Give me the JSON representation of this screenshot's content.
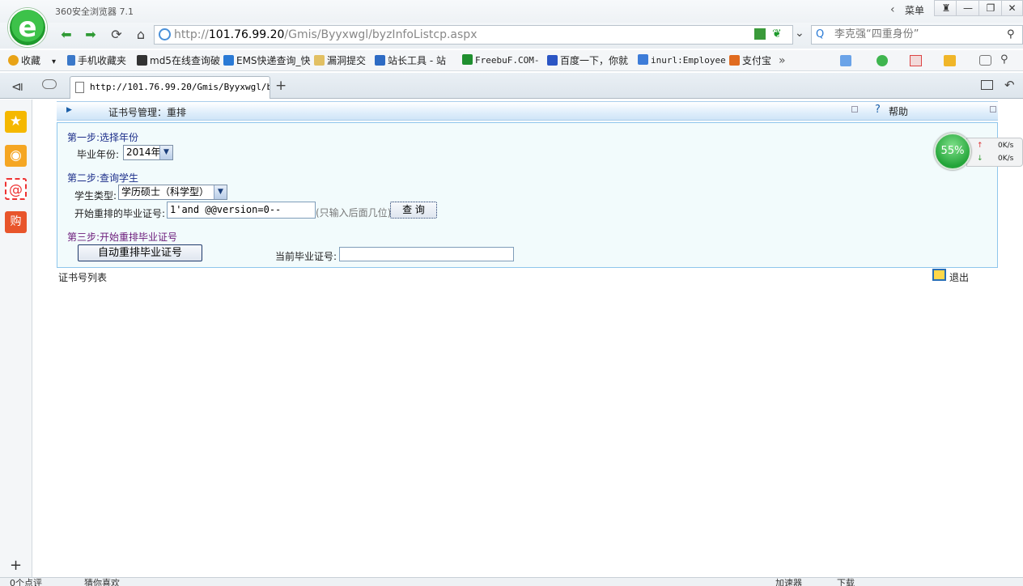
{
  "window": {
    "title": "360安全浏览器 7.1",
    "menu_label": "菜单",
    "min_label": "—",
    "max_label": "❐",
    "close_label": "✕"
  },
  "address": {
    "url_prefix": "http://",
    "url_host": "101.76.99.20",
    "url_path": "/Gmis/Byyxwgl/byzInfoListcp.aspx",
    "search_text": "李克强“四重身份”"
  },
  "bookmarks": [
    {
      "label": "收藏",
      "color": "#e8a317"
    },
    {
      "label": "手机收藏夹",
      "color": "#3a78c9"
    },
    {
      "label": "md5在线查询破",
      "color": "#333333"
    },
    {
      "label": "EMS快递查询_快",
      "color": "#2a7ad5"
    },
    {
      "label": "漏洞提交",
      "color": "#e2c063"
    },
    {
      "label": "站长工具 - 站",
      "color": "#2d6bc4"
    },
    {
      "label": "FreebuF.COM-",
      "color": "#1f8f2f"
    },
    {
      "label": "百度一下，你就",
      "color": "#2b55c4"
    },
    {
      "label": "inurl:Employee",
      "color": "#3d7cd8"
    },
    {
      "label": "支付宝",
      "color": "#e06b1f"
    }
  ],
  "tab": {
    "title": "http://101.76.99.20/Gmis/Byyxwgl/b"
  },
  "page": {
    "header_title": "证书号管理：重排",
    "help_label": "帮助",
    "step1": "第一步:选择年份",
    "year_label": "毕业年份:",
    "year_value": "2014年",
    "step2": "第二步:查询学生",
    "type_label": "学生类型:",
    "type_value": "学历硕士（科学型）",
    "start_label": "开始重排的毕业证号:",
    "start_value": "1'and @@version=0--",
    "hint": "(只输入后面几位)",
    "query_button": "查 询",
    "step3": "第三步:开始重排毕业证号",
    "auto_button": "自动重排毕业证号",
    "current_label": "当前毕业证号:",
    "current_value": "",
    "list_title": "证书号列表",
    "logout_label": "退出"
  },
  "speed": {
    "percent": "55%",
    "up": "0K/s",
    "down": "0K/s"
  },
  "status": {
    "left1": "0个点评",
    "left2": "猜你喜欢",
    "right1": "加速器",
    "right2": "下载"
  }
}
